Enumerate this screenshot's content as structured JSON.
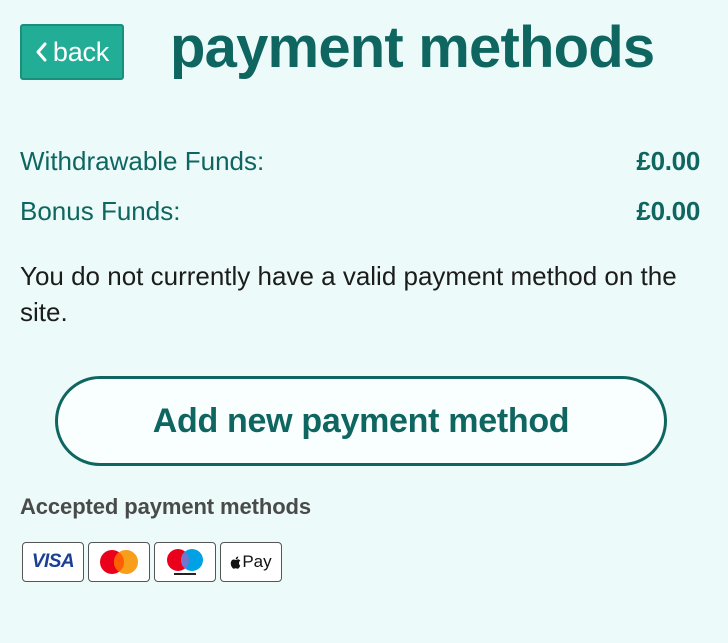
{
  "header": {
    "back_label": "back",
    "title": "payment methods"
  },
  "funds": [
    {
      "label": "Withdrawable Funds:",
      "value": "£0.00"
    },
    {
      "label": "Bonus Funds:",
      "value": "£0.00"
    }
  ],
  "notice": "You do not currently have a valid payment method on the site.",
  "add_button_label": "Add new payment method",
  "accepted": {
    "title": "Accepted payment methods",
    "cards": [
      {
        "name": "visa",
        "text": "VISA",
        "icon": "visa-icon"
      },
      {
        "name": "mastercard",
        "text": "",
        "icon": "mastercard-icon"
      },
      {
        "name": "maestro",
        "text": "",
        "icon": "maestro-icon"
      },
      {
        "name": "apple-pay",
        "text": "Pay",
        "icon": "apple-pay-icon"
      }
    ]
  },
  "colors": {
    "background": "#ecfbf9",
    "brand_dark": "#0f6661",
    "back_button": "#22ae96",
    "text": "#1c1c1c",
    "muted": "#4a4a4a"
  }
}
